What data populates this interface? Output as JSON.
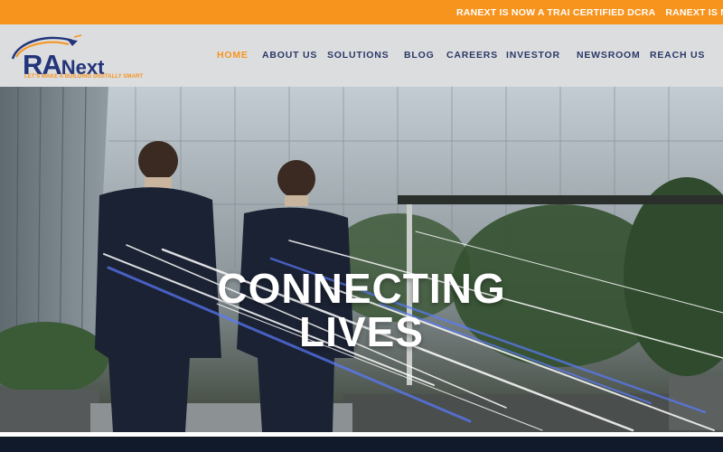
{
  "ticker": {
    "items": [
      "RANEXT IS NOW A TRAI CERTIFIED DCRA",
      "RANEXT IS NOW A TRAI CERTIFIED DCRA"
    ]
  },
  "logo": {
    "ra": "RA",
    "next": "Next",
    "tagline": "LET'S MAKE A BUILDING DIGITALLY SMART"
  },
  "nav": {
    "items": [
      {
        "label": "HOME"
      },
      {
        "label": "ABOUT US"
      },
      {
        "label": "SOLUTIONS"
      },
      {
        "label": "BLOG"
      },
      {
        "label": "CAREERS"
      },
      {
        "label": "INVESTOR"
      },
      {
        "label": "NEWSROOM"
      },
      {
        "label": "REACH US"
      }
    ]
  },
  "hero": {
    "line1": "CONNECTING",
    "line2": "LIVES"
  },
  "colors": {
    "accent": "#f7941d",
    "brand": "#23357a",
    "nav_text": "#2a3966"
  }
}
